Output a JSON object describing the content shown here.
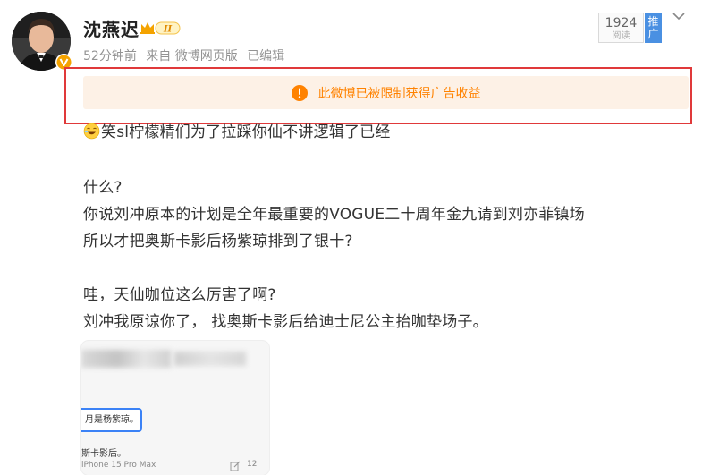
{
  "post": {
    "username": "沈燕迟",
    "level_badge": "II",
    "time": "52分钟前",
    "source": "来自 微博网页版",
    "edited": "已编辑",
    "read_count": "1924",
    "read_label": "阅读",
    "push_label": "推广"
  },
  "notice": {
    "text": "此微博已被限制获得广告收益",
    "color": "#ff8200",
    "background": "#fdf1e6"
  },
  "content": {
    "line1": "笑sl柠檬精们为了拉踩你仙不讲逻辑了已经",
    "line2": "什么?",
    "line3": "你说刘冲原本的计划是全年最重要的VOGUE二十周年金九请到刘亦菲镇场",
    "line4": "所以才把奥斯卡影后杨紫琼排到了银十?",
    "line5": "哇，天仙咖位这么厉害了啊?",
    "line6": "刘冲我原谅你了， 找奥斯卡影后给迪士尼公主抬咖垫场子。"
  },
  "image_preview": {
    "card_text": "月是杨紫琼。",
    "text1": "斯卡影后。",
    "footer": "iPhone 15 Pro Max",
    "count": "12"
  },
  "icons": {
    "avatar_badge": "verified-v-icon",
    "level": "crown-level-icon",
    "menu": "chevron-down-icon",
    "notice": "exclamation-circle-icon",
    "emoji": "laugh-emoji-icon",
    "edit": "edit-icon"
  },
  "colors": {
    "highlight_frame": "#e0393a",
    "push_button": "#4a90e2",
    "badge": "#f4a300"
  }
}
